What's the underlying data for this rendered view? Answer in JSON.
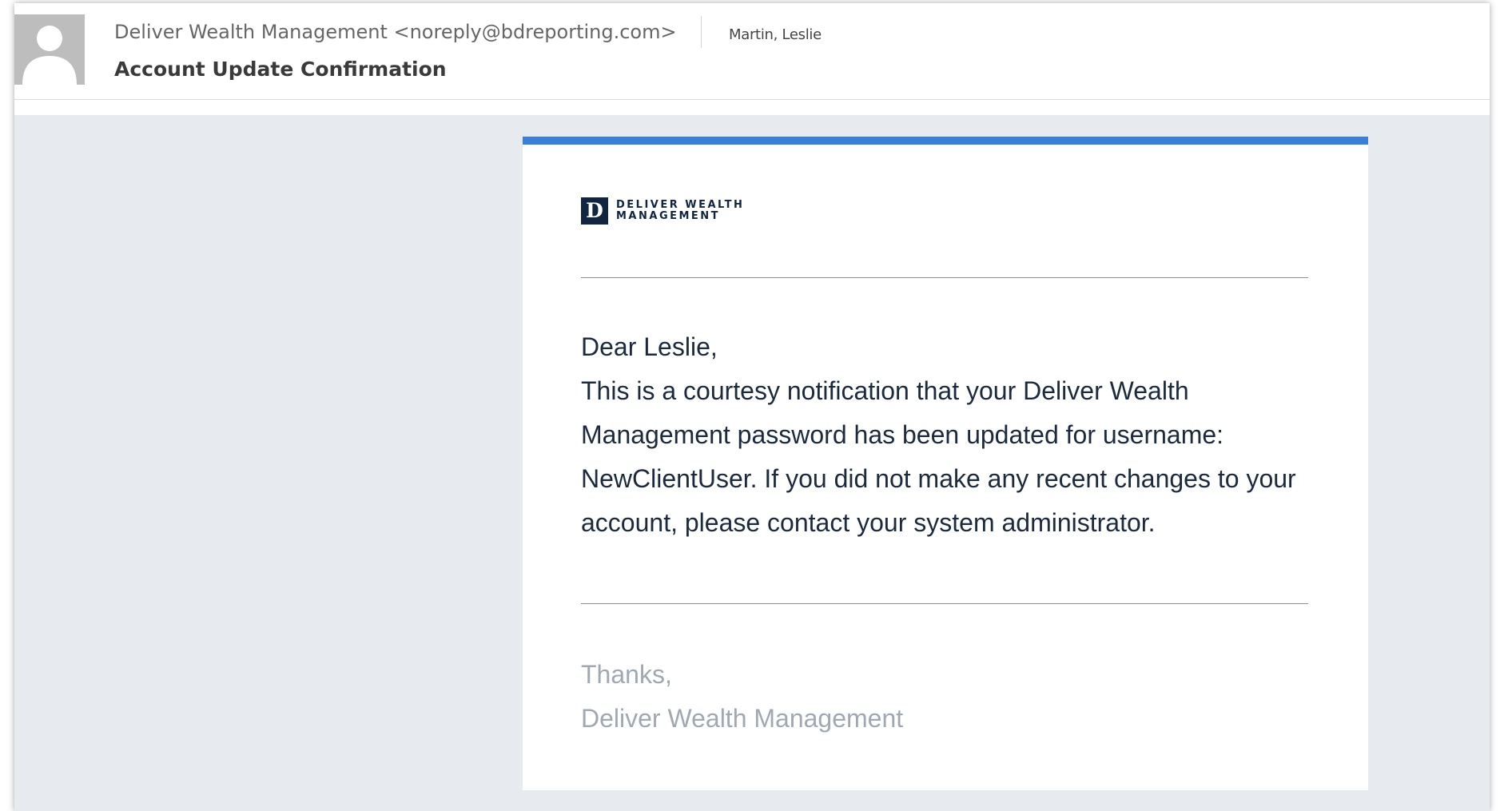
{
  "header": {
    "sender": "Deliver Wealth Management <noreply@bdreporting.com>",
    "recipient": "Martin, Leslie",
    "subject": "Account Update Confirmation",
    "avatar_icon": "person-silhouette-icon"
  },
  "email": {
    "accent_color": "#3a80da",
    "logo": {
      "mark": "D",
      "line1": "DELIVER WEALTH",
      "line2": "MANAGEMENT"
    },
    "greeting": "Dear Leslie,",
    "body": "This is a courtesy notification that your Deliver Wealth Management password has been updated for username: NewClientUser. If you did not make any recent changes to your account, please contact your system administrator.",
    "closing": "Thanks,",
    "signature": "Deliver Wealth Management"
  }
}
